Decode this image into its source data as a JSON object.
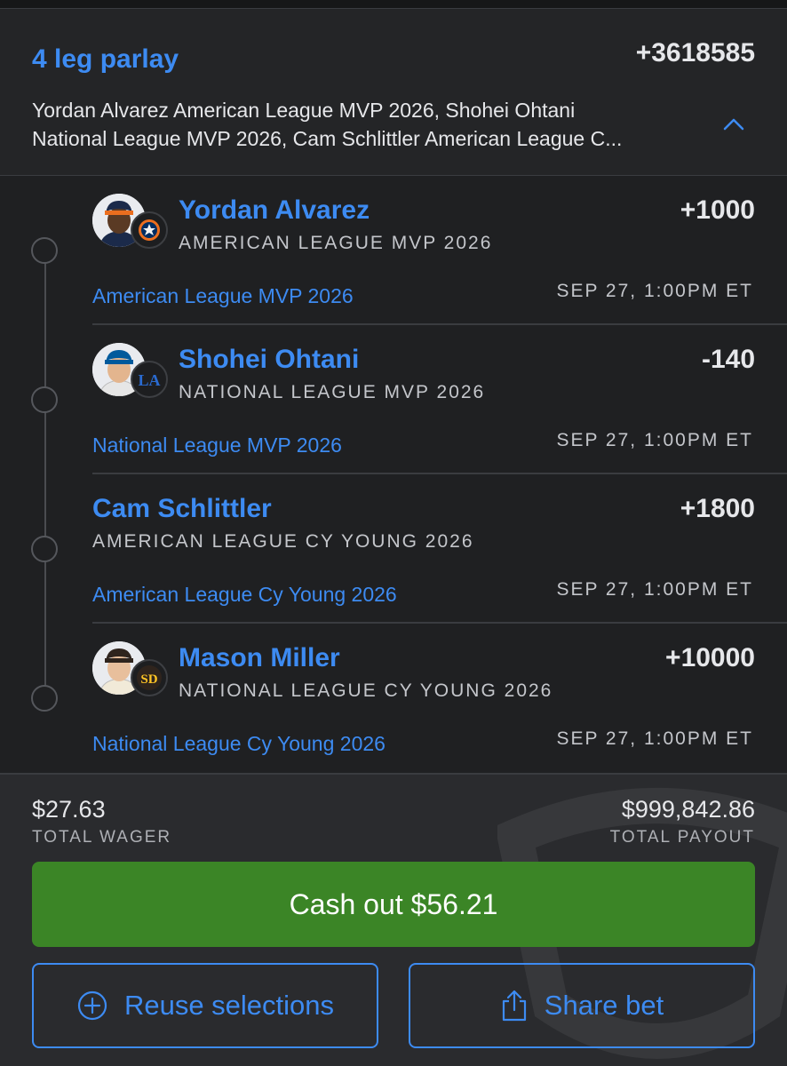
{
  "parlay": {
    "title": "4 leg parlay",
    "odds": "+3618585",
    "summary_line1": "Yordan Alvarez American League MVP 2026, Shohei Ohtani",
    "summary_line2": "National League MVP 2026, Cam Schlittler American League C..."
  },
  "legs": [
    {
      "name": "Yordan Alvarez",
      "market": "AMERICAN LEAGUE MVP 2026",
      "odds": "+1000",
      "market_link": "American League MVP 2026",
      "date": "SEP 27, 1:00PM ET",
      "team_logo": "astros-logo"
    },
    {
      "name": "Shohei Ohtani",
      "market": "NATIONAL LEAGUE MVP 2026",
      "odds": "-140",
      "market_link": "National League MVP 2026",
      "date": "SEP 27, 1:00PM ET",
      "team_logo": "dodgers-logo"
    },
    {
      "name": "Cam Schlittler",
      "market": "AMERICAN LEAGUE CY YOUNG 2026",
      "odds": "+1800",
      "market_link": "American League Cy Young 2026",
      "date": "SEP 27, 1:00PM ET"
    },
    {
      "name": "Mason Miller",
      "market": "NATIONAL LEAGUE CY YOUNG 2026",
      "odds": "+10000",
      "market_link": "National League Cy Young 2026",
      "date": "SEP 27, 1:00PM ET",
      "team_logo": "padres-logo"
    }
  ],
  "footer": {
    "wager_value": "$27.63",
    "wager_label": "TOTAL WAGER",
    "payout_value": "$999,842.86",
    "payout_label": "TOTAL PAYOUT",
    "cashout_label": "Cash out $56.21",
    "reuse_label": "Reuse selections",
    "share_label": "Share bet"
  },
  "colors": {
    "accent": "#3d8bf2",
    "cashout": "#3b8526",
    "background": "#1f2022"
  }
}
